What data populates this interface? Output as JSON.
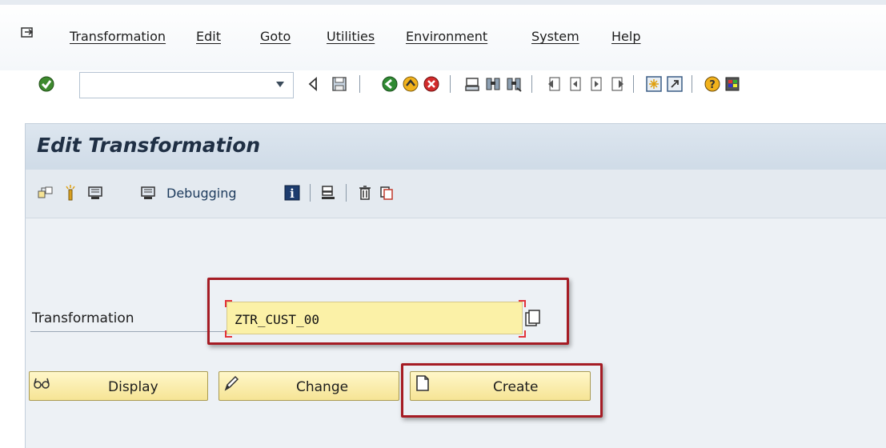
{
  "menu": {
    "items": [
      "Transformation",
      "Edit",
      "Goto",
      "Utilities",
      "Environment",
      "System",
      "Help"
    ]
  },
  "toolbar": {
    "command_field_value": "",
    "icons": [
      "enter-icon",
      "back-arrow-icon",
      "save-icon",
      "back-icon",
      "exit-icon",
      "cancel-icon",
      "print-icon",
      "find-icon",
      "find-next-icon",
      "first-page-icon",
      "previous-page-icon",
      "next-page-icon",
      "last-page-icon",
      "new-session-icon",
      "shortcut-icon",
      "help-icon",
      "customize-layout-icon"
    ]
  },
  "header": {
    "title": "Edit Transformation"
  },
  "app_toolbar": {
    "debugging_label": "Debugging"
  },
  "form": {
    "transformation_label": "Transformation",
    "transformation_value": "ZTR_CUST_00"
  },
  "buttons": {
    "display": "Display",
    "change": "Change",
    "create": "Create"
  },
  "colors": {
    "highlight": "#a51c24",
    "input_background": "#fbf1a7",
    "button_background": "#f6e495",
    "header_background": "#d6e0ea"
  }
}
